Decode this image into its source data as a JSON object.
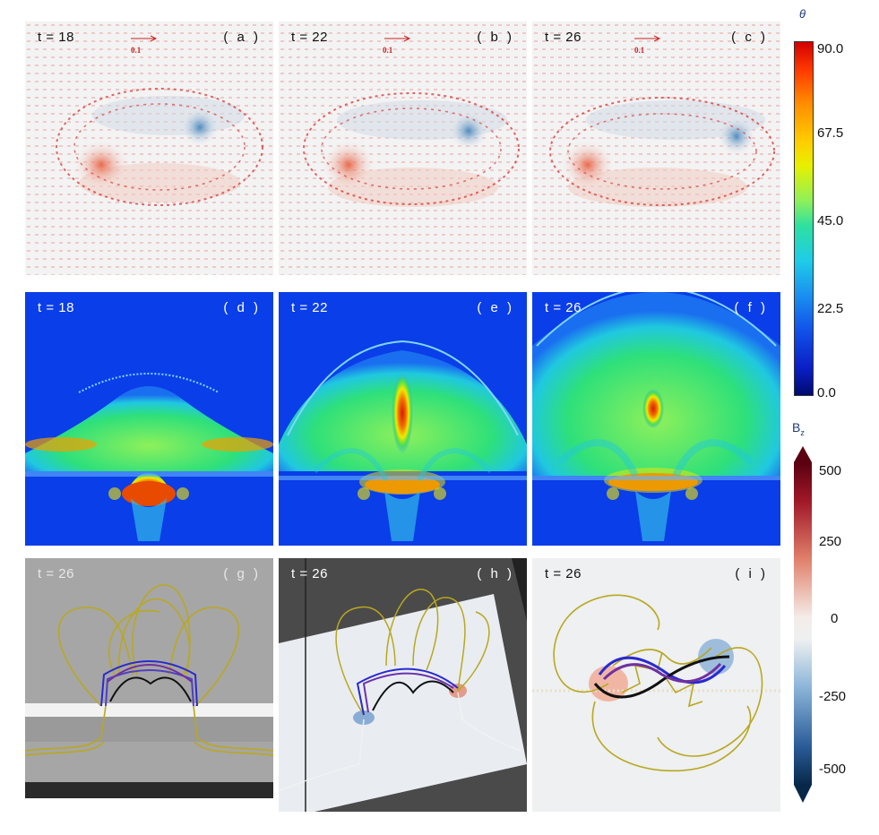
{
  "panels": [
    {
      "time": "t = 18",
      "id": "( a )",
      "arrow_label": "0.1"
    },
    {
      "time": "t = 22",
      "id": "( b )",
      "arrow_label": "0.1"
    },
    {
      "time": "t = 26",
      "id": "( c )",
      "arrow_label": "0.1"
    },
    {
      "time": "t = 18",
      "id": "( d )"
    },
    {
      "time": "t = 22",
      "id": "( e )"
    },
    {
      "time": "t = 26",
      "id": "( f )"
    },
    {
      "time": "t = 26",
      "id": "( g )"
    },
    {
      "time": "t = 26",
      "id": "( h )"
    },
    {
      "time": "t = 26",
      "id": "( i )"
    }
  ],
  "colorbar_theta": {
    "title": "θ",
    "ticks": [
      "90.0",
      "67.5",
      "45.0",
      "22.5",
      "0.0"
    ]
  },
  "colorbar_bz": {
    "title": "B",
    "subscript": "z",
    "ticks": [
      "500",
      "250",
      "0",
      "-250",
      "-500"
    ]
  }
}
